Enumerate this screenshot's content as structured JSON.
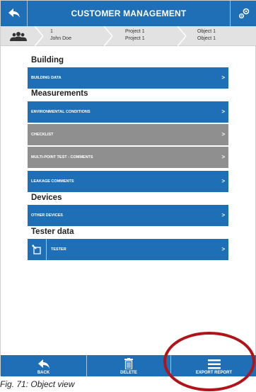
{
  "header": {
    "title": "CUSTOMER MANAGEMENT"
  },
  "breadcrumb": {
    "items": [
      {
        "line1": "1",
        "line2": "John Doe"
      },
      {
        "line1": "Project 1",
        "line2": "Project 1"
      },
      {
        "line1": "Object 1",
        "line2": "Object 1"
      }
    ]
  },
  "sections": {
    "building": {
      "title": "Building",
      "items": [
        {
          "label": "BUILDING DATA"
        }
      ]
    },
    "measurements": {
      "title": "Measurements",
      "items": [
        {
          "label": "ENVIRONMENTAL CONDITIONS",
          "state": "active"
        },
        {
          "label": "CHECKLIST",
          "state": "disabled"
        },
        {
          "label": "MULTI-POINT TEST - COMMENTS",
          "state": "disabled"
        },
        {
          "label": "LEAKAGE COMMENTS",
          "state": "active"
        }
      ]
    },
    "devices": {
      "title": "Devices",
      "items": [
        {
          "label": "OTHER DEVICES"
        }
      ]
    },
    "tester": {
      "title": "Tester data",
      "items": [
        {
          "label": "TESTER"
        }
      ]
    }
  },
  "chevron": ">",
  "bottom_bar": {
    "back": "BACK",
    "delete": "DELETE",
    "export": "EXPORT REPORT"
  },
  "caption": "Fig. 71: Object view",
  "colors": {
    "primary": "#1f6fb7",
    "disabled": "#8f8f8f",
    "highlight": "#b0141b",
    "breadcrumb_bg": "#e2e2e2"
  },
  "icons": {
    "header_left": "back-arrow-icon",
    "header_right": "settings-icon",
    "breadcrumb": "customers-group-icon",
    "tester": "tester-edit-icon",
    "back": "back-arrow-icon",
    "delete": "trash-icon",
    "export": "menu-lines-icon"
  }
}
